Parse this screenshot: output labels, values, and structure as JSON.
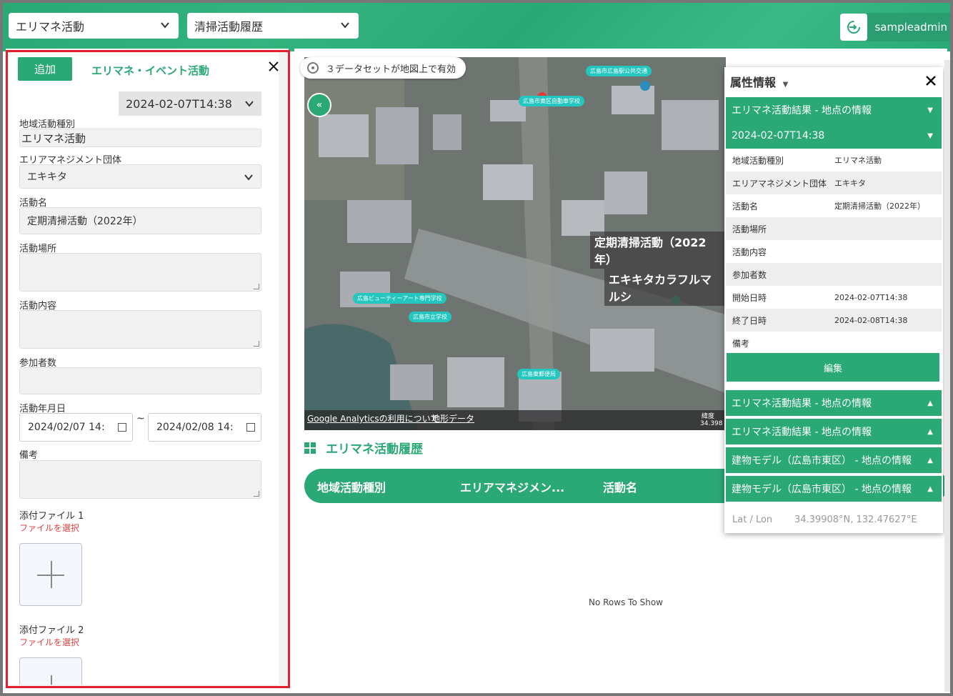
{
  "header": {
    "select1": "エリマネ活動",
    "select2": "清掃活動履歴",
    "user": "sampleadmin"
  },
  "form": {
    "add_button": "追加",
    "title": "エリマネ・イベント活動",
    "datetime_select": "2024-02-07T14:38",
    "labels": {
      "activity_type": "地域活動種別",
      "org": "エリアマネジメント団体",
      "activity_name": "活動名",
      "location": "活動場所",
      "content": "活動内容",
      "participants": "参加者数",
      "date": "活動年月日",
      "notes": "備考",
      "file1": "添付ファイル 1",
      "file2": "添付ファイル 2"
    },
    "values": {
      "activity_type": "エリマネ活動",
      "org": "エキキタ",
      "activity_name": "定期清掃活動（2022年）",
      "date_start": "2024/02/07 14:",
      "date_end": "2024/02/08 14:",
      "tilde": "~"
    },
    "file_select": "ファイルを選択"
  },
  "map": {
    "datasets_pill": "３データセットが地図上で有効",
    "big_label1": "定期清掃活動（2022年）",
    "big_label2": "エキキタカラフルマルシ",
    "footer_link1": "Google Analyticsの利用について",
    "footer_link2": "地形データ",
    "coord_label": "緯度",
    "coord_value": "34.398"
  },
  "history": {
    "title": "エリマネ活動履歴",
    "columns": [
      "地域活動種別",
      "エリアマネジメン...",
      "活動名"
    ],
    "empty": "No Rows To Show"
  },
  "attr": {
    "title": "属性情報",
    "group1": "エリマネ活動結果 - 地点の情報",
    "group1_sub": "2024-02-07T14:38",
    "rows": [
      {
        "k": "地域活動種別",
        "v": "エリマネ活動"
      },
      {
        "k": "エリアマネジメント団体",
        "v": "エキキタ"
      },
      {
        "k": "活動名",
        "v": "定期清掃活動（2022年）"
      },
      {
        "k": "活動場所",
        "v": ""
      },
      {
        "k": "活動内容",
        "v": ""
      },
      {
        "k": "参加者数",
        "v": ""
      },
      {
        "k": "開始日時",
        "v": "2024-02-07T14:38"
      },
      {
        "k": "終了日時",
        "v": "2024-02-08T14:38"
      },
      {
        "k": "備考",
        "v": ""
      }
    ],
    "edit": "編集",
    "groups": [
      "エリマネ活動結果 - 地点の情報",
      "エリマネ活動結果 - 地点の情報",
      "建物モデル（広島市東区） - 地点の情報",
      "建物モデル（広島市東区） - 地点の情報"
    ],
    "latlon_label": "Lat / Lon",
    "latlon_value": "34.39908°N, 132.47627°E"
  },
  "colors": {
    "accent": "#2aa876",
    "highlight": "#e0202c",
    "map_tag": "#23c7c0"
  }
}
